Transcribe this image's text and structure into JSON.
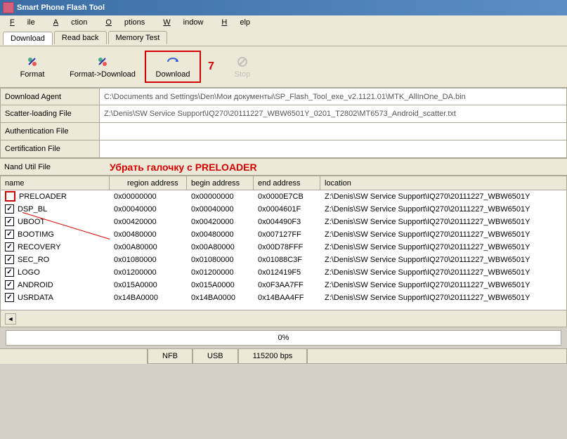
{
  "window": {
    "title": "Smart Phone Flash Tool"
  },
  "menu": {
    "file": "File",
    "action": "Action",
    "options": "Options",
    "window": "Window",
    "help": "Help"
  },
  "tabs": {
    "download": "Download",
    "readback": "Read back",
    "memtest": "Memory Test"
  },
  "toolbar": {
    "format": "Format",
    "format_download": "Format->Download",
    "download": "Download",
    "stop": "Stop",
    "annotation": "7"
  },
  "files": {
    "download_agent_label": "Download Agent",
    "download_agent_value": "C:\\Documents and Settings\\Den\\Мои документы\\SP_Flash_Tool_exe_v2.1121.01\\MTK_AllInOne_DA.bin",
    "scatter_label": "Scatter-loading File",
    "scatter_value": "Z:\\Denis\\SW Service Support\\IQ270\\20111227_WBW6501Y_0201_T2802\\MT6573_Android_scatter.txt",
    "auth_label": "Authentication File",
    "auth_value": "",
    "cert_label": "Certification File",
    "cert_value": "",
    "nand_label": "Nand Util File"
  },
  "annotation": {
    "text": "Убрать галочку с PRELOADER"
  },
  "table": {
    "headers": {
      "name": "name",
      "region": "region address",
      "begin": "begin address",
      "end": "end address",
      "location": "location"
    },
    "rows": [
      {
        "checked": false,
        "highlight": true,
        "name": "PRELOADER",
        "region": "0x00000000",
        "begin": "0x00000000",
        "end": "0x0000E7CB",
        "location": "Z:\\Denis\\SW Service Support\\IQ270\\20111227_WBW6501Y"
      },
      {
        "checked": true,
        "name": "DSP_BL",
        "region": "0x00040000",
        "begin": "0x00040000",
        "end": "0x0004601F",
        "location": "Z:\\Denis\\SW Service Support\\IQ270\\20111227_WBW6501Y"
      },
      {
        "checked": true,
        "name": "UBOOT",
        "region": "0x00420000",
        "begin": "0x00420000",
        "end": "0x004490F3",
        "location": "Z:\\Denis\\SW Service Support\\IQ270\\20111227_WBW6501Y"
      },
      {
        "checked": true,
        "name": "BOOTIMG",
        "region": "0x00480000",
        "begin": "0x00480000",
        "end": "0x007127FF",
        "location": "Z:\\Denis\\SW Service Support\\IQ270\\20111227_WBW6501Y"
      },
      {
        "checked": true,
        "name": "RECOVERY",
        "region": "0x00A80000",
        "begin": "0x00A80000",
        "end": "0x00D78FFF",
        "location": "Z:\\Denis\\SW Service Support\\IQ270\\20111227_WBW6501Y"
      },
      {
        "checked": true,
        "name": "SEC_RO",
        "region": "0x01080000",
        "begin": "0x01080000",
        "end": "0x01088C3F",
        "location": "Z:\\Denis\\SW Service Support\\IQ270\\20111227_WBW6501Y"
      },
      {
        "checked": true,
        "name": "LOGO",
        "region": "0x01200000",
        "begin": "0x01200000",
        "end": "0x012419F5",
        "location": "Z:\\Denis\\SW Service Support\\IQ270\\20111227_WBW6501Y"
      },
      {
        "checked": true,
        "name": "ANDROID",
        "region": "0x015A0000",
        "begin": "0x015A0000",
        "end": "0x0F3AA7FF",
        "location": "Z:\\Denis\\SW Service Support\\IQ270\\20111227_WBW6501Y"
      },
      {
        "checked": true,
        "name": "USRDATA",
        "region": "0x14BA0000",
        "begin": "0x14BA0000",
        "end": "0x14BAA4FF",
        "location": "Z:\\Denis\\SW Service Support\\IQ270\\20111227_WBW6501Y"
      }
    ]
  },
  "progress": {
    "text": "0%"
  },
  "status": {
    "nfb": "NFB",
    "usb": "USB",
    "baud": "115200 bps"
  }
}
